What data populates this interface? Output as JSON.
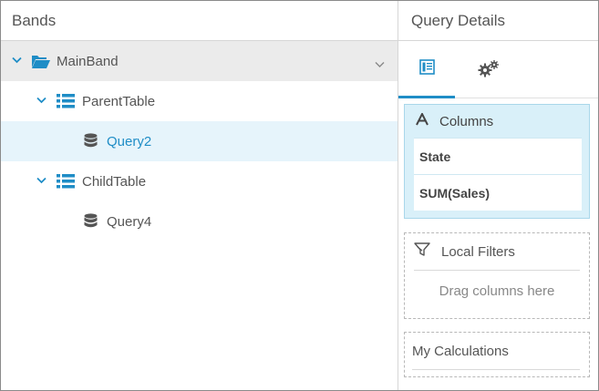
{
  "left": {
    "title": "Bands",
    "tree": {
      "main": "MainBand",
      "parent_table": "ParentTable",
      "query2": "Query2",
      "child_table": "ChildTable",
      "query4": "Query4"
    }
  },
  "right": {
    "title": "Query Details",
    "columns": {
      "heading": "Columns",
      "items": [
        "State",
        "SUM(Sales)"
      ]
    },
    "filters": {
      "heading": "Local Filters",
      "hint": "Drag columns here"
    },
    "calculations": {
      "heading": "My Calculations"
    }
  },
  "colors": {
    "accent": "#1f8dc6",
    "selected_bg": "#e6f4fb",
    "columns_bg": "#d9f0f9"
  }
}
